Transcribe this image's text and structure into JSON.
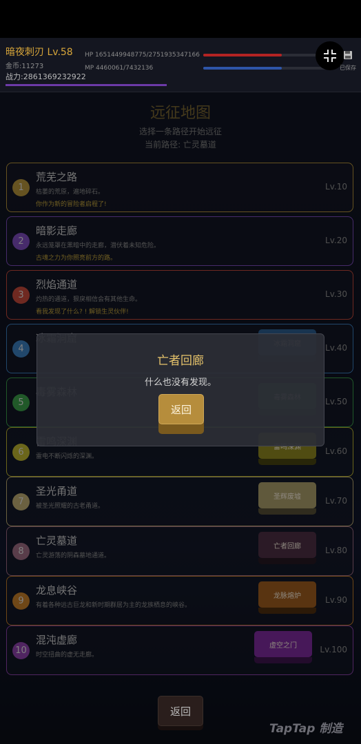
{
  "header": {
    "player_name": "暗夜刺刃 Lv.58",
    "gold": "金币:11273",
    "power": "战力:2861369232922",
    "hp_text": "HP 1651449948775/2751935347166",
    "hp_ratio": 0.6,
    "hp_color": "#b32323",
    "mp_text": "MP 4460061/7432136",
    "mp_ratio": 0.6,
    "mp_color": "#2e55a8",
    "save_label": "已保存"
  },
  "map": {
    "title": "远征地图",
    "subtitle": "选择一条路径开始远征",
    "current_path": "当前路径: 亡灵墓道"
  },
  "routes": [
    {
      "num": "1",
      "name": "荒芜之路",
      "desc": "枯萎的荒原，遍地碎石。",
      "note": "你作为新的冒险者启程了!",
      "level": "Lv.10",
      "color": "#b0903a"
    },
    {
      "num": "2",
      "name": "暗影走廊",
      "desc": "永远笼罩在黑暗中的走廊，潜伏着未知危险。",
      "note": "古魂之力为你照亮前方的路。",
      "level": "Lv.20",
      "color": "#7a4ab8"
    },
    {
      "num": "3",
      "name": "烈焰通道",
      "desc": "灼热的通道，狠戾相信会有其他生命。",
      "note": "看我发现了什么? ! 解锁生灵伙伴!",
      "level": "Lv.30",
      "color": "#c0483a"
    },
    {
      "num": "4",
      "name": "冰霜洞窟",
      "desc": "",
      "note": "",
      "level": "Lv.40",
      "color": "#3a7ab8",
      "button": "冰霜洞窟",
      "btn_color": "#2a5a8a"
    },
    {
      "num": "5",
      "name": "毒雾森林",
      "desc": "",
      "note": "",
      "level": "Lv.50",
      "color": "#3a9a48",
      "button": "毒雾森林",
      "btn_color": "#2a6a38"
    },
    {
      "num": "6",
      "name": "雷鸣深渊",
      "desc": "雷电不断闪烁的深渊。",
      "note": "",
      "level": "Lv.60",
      "color": "#b8b030",
      "button": "雷鸣深渊",
      "btn_color": "#8a8420"
    },
    {
      "num": "7",
      "name": "圣光甬道",
      "desc": "被圣光照耀的古老甬道。",
      "note": "",
      "level": "Lv.70",
      "color": "#b8a870",
      "button": "圣辉废墟",
      "btn_color": "#a69a68"
    },
    {
      "num": "8",
      "name": "亡灵墓道",
      "desc": "亡灵游荡的阴森墓地通道。",
      "note": "",
      "level": "Lv.80",
      "color": "#9a6a80",
      "button": "亡者回廊",
      "btn_color": "#4a2e42"
    },
    {
      "num": "9",
      "name": "龙息峡谷",
      "desc": "有着各种远古巨龙和新时期群居为主的龙族栖息的峡谷。",
      "note": "",
      "level": "Lv.90",
      "color": "#c07a28",
      "button": "龙脉熔炉",
      "btn_color": "#9a5a1e"
    },
    {
      "num": "10",
      "name": "混沌虚廊",
      "desc": "时空扭曲的虚无走廊。",
      "note": "",
      "level": "Lv.100",
      "color": "#8a40a8",
      "button": "虚空之门",
      "btn_color": "#7a2a9a"
    }
  ],
  "modal": {
    "title": "亡者回廊",
    "message": "什么也没有发现。",
    "button": "返回"
  },
  "footer": {
    "back_button": "返回",
    "watermark": "TapTap 制造"
  }
}
